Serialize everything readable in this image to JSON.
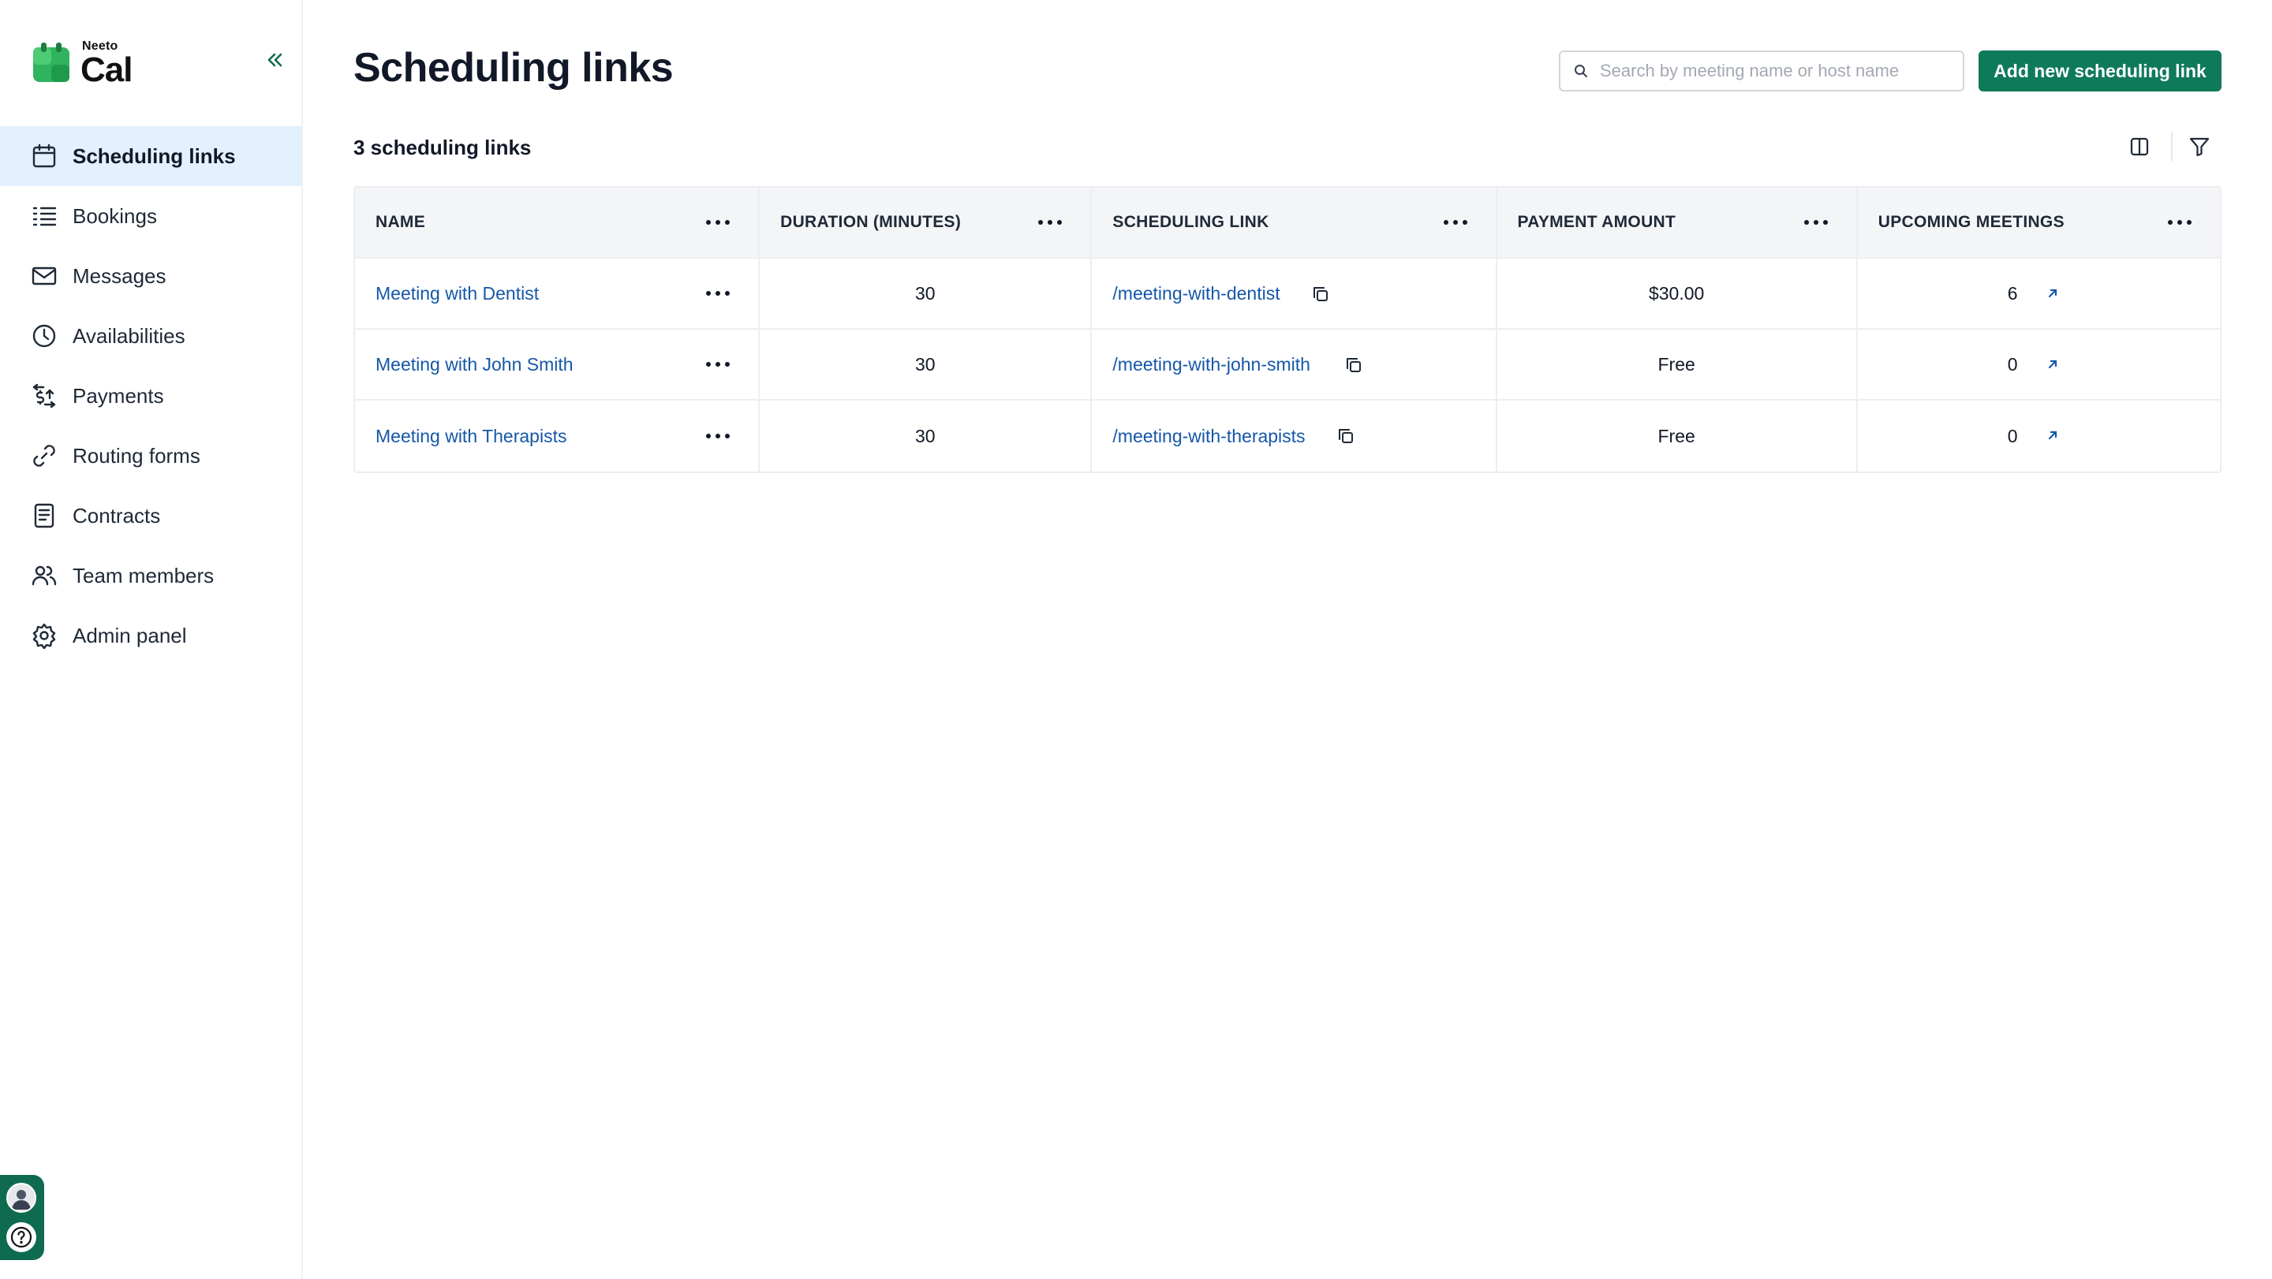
{
  "app": {
    "logo_small": "Neeto",
    "logo_big": "Cal"
  },
  "sidebar": {
    "items": [
      {
        "label": "Scheduling links",
        "icon": "calendar-icon",
        "active": true
      },
      {
        "label": "Bookings",
        "icon": "list-icon",
        "active": false
      },
      {
        "label": "Messages",
        "icon": "mail-icon",
        "active": false
      },
      {
        "label": "Availabilities",
        "icon": "clock-icon",
        "active": false
      },
      {
        "label": "Payments",
        "icon": "payments-icon",
        "active": false
      },
      {
        "label": "Routing forms",
        "icon": "link-icon",
        "active": false
      },
      {
        "label": "Contracts",
        "icon": "document-icon",
        "active": false
      },
      {
        "label": "Team members",
        "icon": "users-icon",
        "active": false
      },
      {
        "label": "Admin panel",
        "icon": "gear-icon",
        "active": false
      }
    ]
  },
  "header": {
    "title": "Scheduling links",
    "search_placeholder": "Search by meeting name or host name",
    "add_button": "Add new scheduling link"
  },
  "summary": {
    "count_label": "3 scheduling links"
  },
  "table": {
    "columns": [
      "NAME",
      "DURATION (MINUTES)",
      "SCHEDULING LINK",
      "PAYMENT AMOUNT",
      "UPCOMING MEETINGS"
    ],
    "rows": [
      {
        "name": "Meeting with Dentist",
        "duration": "30",
        "link": "/meeting-with-dentist",
        "payment": "$30.00",
        "upcoming": "6"
      },
      {
        "name": "Meeting with John Smith",
        "duration": "30",
        "link": "/meeting-with-john-smith",
        "payment": "Free",
        "upcoming": "0"
      },
      {
        "name": "Meeting with Therapists",
        "duration": "30",
        "link": "/meeting-with-therapists",
        "payment": "Free",
        "upcoming": "0"
      }
    ]
  },
  "colors": {
    "primary": "#0f7a5a",
    "link": "#1557a8",
    "active_nav_bg": "#e3f0fd"
  }
}
